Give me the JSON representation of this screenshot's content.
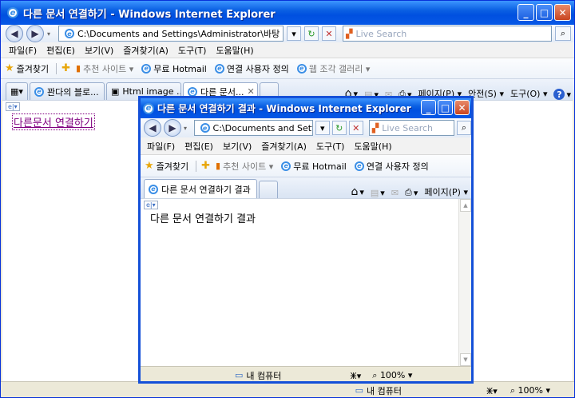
{
  "back_window": {
    "title": "다른 문서 연결하기 - Windows Internet Explorer",
    "address": "C:\\Documents and Settings\\Administrator\\바탕 화면\\연결하기.html",
    "search_placeholder": "Live Search",
    "menu": [
      "파일(F)",
      "편집(E)",
      "보기(V)",
      "즐겨찾기(A)",
      "도구(T)",
      "도움말(H)"
    ],
    "favorites_label": "즐겨찾기",
    "favbar": [
      "추천 사이트 ▾",
      "무료 Hotmail",
      "연결 사용자 정의",
      "웹 조각 갤러리 ▾"
    ],
    "tabs": [
      "꽌다의 블로...",
      "Html image ...",
      "다른 문서..."
    ],
    "cmd": [
      "페이지(P) ▾",
      "안전(S) ▾",
      "도구(O) ▾"
    ],
    "link_text": "다른문서 연결하기",
    "status_zone": "내 컴퓨터",
    "zoom": "100%"
  },
  "front_window": {
    "title": "다른 문서 연결하기 결과 - Windows Internet Explorer",
    "address": "C:\\Documents and Settings",
    "search_placeholder": "Live Search",
    "menu": [
      "파일(F)",
      "편집(E)",
      "보기(V)",
      "즐겨찾기(A)",
      "도구(T)",
      "도움말(H)"
    ],
    "favorites_label": "즐겨찾기",
    "favbar": [
      "추천 사이트 ▾",
      "무료 Hotmail",
      "연결 사용자 정의"
    ],
    "tab_title": "다른 문서 연결하기 결과",
    "cmd": [
      "페이지(P) ▾"
    ],
    "body_text": "다른 문서 연결하기 결과",
    "status_zone": "내 컴퓨터",
    "zoom": "100%"
  },
  "icons": {
    "minimize": "_",
    "maximize": "□",
    "close": "✕",
    "back": "◀",
    "forward": "▶",
    "refresh": "↻",
    "stop": "✕",
    "search": "🔍",
    "home": "⌂",
    "rss": "▤",
    "print": "⎙",
    "help": "?"
  }
}
